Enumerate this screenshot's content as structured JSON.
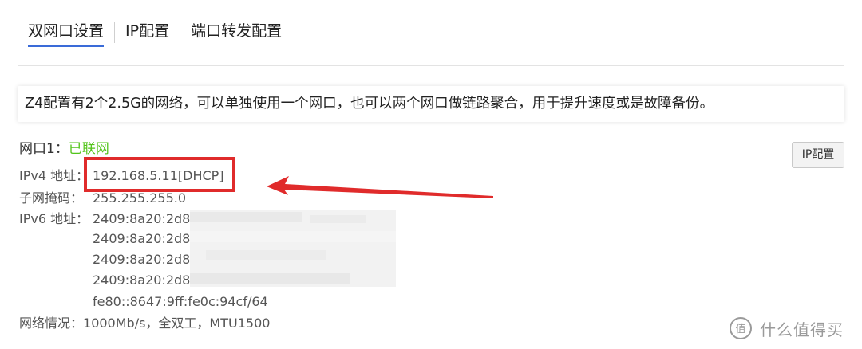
{
  "tabs": [
    {
      "label": "双网口设置",
      "active": true
    },
    {
      "label": "IP配置",
      "active": false
    },
    {
      "label": "端口转发配置",
      "active": false
    }
  ],
  "info_text": "Z4配置有2个2.5G的网络，可以单独使用一个网口，也可以两个网口做链路聚合，用于提升速度或是故障备份。",
  "port": {
    "title": "网口1：",
    "status": "已联网",
    "status_color": "#52c41a",
    "config_button": "IP配置",
    "ipv4_label": "IPv4 地址：",
    "ipv4_value": "192.168.5.11[DHCP]",
    "mask_label": "子网掩码：",
    "mask_value": "255.255.255.0",
    "ipv6_label": "IPv6 地址：",
    "ipv6_values": [
      "2409:8a20:2d8:",
      "2409:8a20:2d8:",
      "2409:8a20:2d8",
      "2409:8a20:2d8:",
      "fe80::8647:9ff:fe0c:94cf/64"
    ],
    "net_label": "网络情况：",
    "net_value": "1000Mb/s，全双工，MTU1500"
  },
  "watermark": {
    "text": "什么值得买"
  },
  "colors": {
    "accent": "#3a6bd8",
    "annotation": "#e02b2b"
  }
}
